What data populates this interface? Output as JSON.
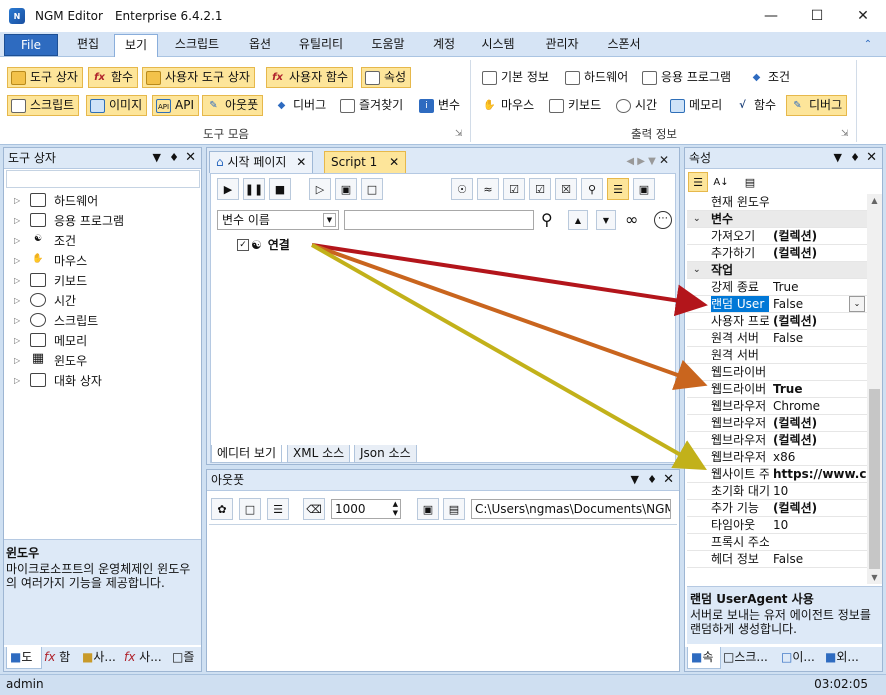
{
  "window": {
    "app_name": "NGM Editor",
    "edition": "Enterprise 6.4.2.1"
  },
  "menu": {
    "file": "File",
    "items": [
      "편집",
      "보기",
      "스크립트",
      "옵션",
      "유틸리티",
      "도움말",
      "계정",
      "시스템",
      "관리자",
      "스폰서"
    ],
    "active": "보기"
  },
  "ribbon": {
    "group1": {
      "row1": [
        "도구 상자",
        "함수",
        "사용자 도구 상자",
        "사용자 함수",
        "속성"
      ],
      "row2": [
        "스크립트",
        "이미지",
        "API",
        "아웃풋",
        "디버그",
        "즐겨찾기",
        "변수"
      ],
      "label": "도구 모음"
    },
    "group2": {
      "row1": [
        "기본 정보",
        "하드웨어",
        "응용 프로그램",
        "조건"
      ],
      "row2": [
        "마우스",
        "키보드",
        "시간",
        "메모리",
        "함수",
        "디버그"
      ],
      "label": "출력 정보"
    }
  },
  "toolbox": {
    "title": "도구 상자",
    "items": [
      "하드웨어",
      "응용 프로그램",
      "조건",
      "마우스",
      "키보드",
      "시간",
      "스크립트",
      "메모리",
      "윈도우",
      "대화 상자"
    ],
    "desc_title": "윈도우",
    "desc_text": "마이크로소프트의 운영체제인 윈도우의 여러가지 기능을 제공합니다.",
    "bottom_tabs": [
      "도",
      "함",
      "사...",
      "사...",
      "즐"
    ]
  },
  "editor": {
    "tabs": [
      "시작 페이지",
      "Script 1"
    ],
    "var_select": "변수 이름",
    "node_label": "연결",
    "view_tabs": [
      "에디터 보기",
      "XML 소스",
      "Json 소스"
    ]
  },
  "output": {
    "title": "아웃풋",
    "count": "1000",
    "path": "C:\\Users\\ngmas\\Documents\\NGM6\\"
  },
  "properties": {
    "title": "속성",
    "rows": [
      {
        "type": "prop",
        "name": "현재 윈도우",
        "value": ""
      },
      {
        "type": "cat",
        "name": "변수"
      },
      {
        "type": "prop",
        "name": "가져오기",
        "value": "(컬렉션)",
        "bold": true
      },
      {
        "type": "prop",
        "name": "추가하기",
        "value": "(컬렉션)",
        "bold": true
      },
      {
        "type": "cat",
        "name": "작업"
      },
      {
        "type": "prop",
        "name": "강제 종료",
        "value": "True"
      },
      {
        "type": "prop",
        "name": "랜덤 User",
        "value": "False",
        "selected": true
      },
      {
        "type": "prop",
        "name": "사용자 프로",
        "value": "(컬렉션)",
        "bold": true
      },
      {
        "type": "prop",
        "name": "원격 서버",
        "value": "False"
      },
      {
        "type": "prop",
        "name": "원격 서버",
        "value": ""
      },
      {
        "type": "prop",
        "name": "웹드라이버",
        "value": ""
      },
      {
        "type": "prop",
        "name": "웹드라이버",
        "value": "True",
        "bold": true
      },
      {
        "type": "prop",
        "name": "웹브라우저",
        "value": "Chrome"
      },
      {
        "type": "prop",
        "name": "웹브라우저",
        "value": "(컬렉션)",
        "bold": true
      },
      {
        "type": "prop",
        "name": "웹브라우저",
        "value": "(컬렉션)",
        "bold": true
      },
      {
        "type": "prop",
        "name": "웹브라우저",
        "value": "x86"
      },
      {
        "type": "prop",
        "name": "웹사이트 주",
        "value": "https://www.c",
        "bold": true
      },
      {
        "type": "prop",
        "name": "초기화 대기",
        "value": "10"
      },
      {
        "type": "prop",
        "name": "추가 기능",
        "value": "(컬렉션)",
        "bold": true
      },
      {
        "type": "prop",
        "name": "타임아웃",
        "value": "10"
      },
      {
        "type": "prop",
        "name": "프록시 주소",
        "value": ""
      },
      {
        "type": "prop",
        "name": "헤더 정보",
        "value": "False"
      }
    ],
    "desc_title": "랜덤 UserAgent 사용",
    "desc_text": "서버로 보내는 유저 에이전트 정보를 랜덤하게 생성합니다.",
    "bottom_tabs": [
      "속",
      "스크...",
      "이...",
      "외..."
    ]
  },
  "statusbar": {
    "user": "admin",
    "time": "03:02:05"
  },
  "colors": {
    "accent": "#2e6bc0",
    "highlight": "#fde59a",
    "arrow1": "#b3151b",
    "arrow2": "#c9651e",
    "arrow3": "#c2b11a"
  }
}
